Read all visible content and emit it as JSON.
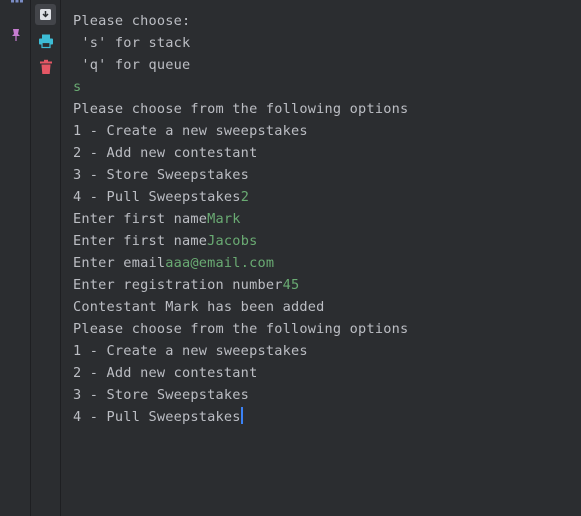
{
  "toolbar": {
    "icons": [
      "grid-icon",
      "pin-icon",
      "scroll-to-end-icon",
      "print-icon",
      "delete-icon"
    ]
  },
  "console": {
    "lines": [
      {
        "out": "Please choose:",
        "in": ""
      },
      {
        "out": " 's' for stack",
        "in": ""
      },
      {
        "out": " 'q' for queue",
        "in": ""
      },
      {
        "out": "",
        "in": "s"
      },
      {
        "out": "Please choose from the following options",
        "in": ""
      },
      {
        "out": "1 - Create a new sweepstakes",
        "in": ""
      },
      {
        "out": "2 - Add new contestant",
        "in": ""
      },
      {
        "out": "3 - Store Sweepstakes",
        "in": ""
      },
      {
        "out": "4 - Pull Sweepstakes",
        "in": "2"
      },
      {
        "out": "Enter first name",
        "in": "Mark"
      },
      {
        "out": "Enter first name",
        "in": "Jacobs"
      },
      {
        "out": "Enter email",
        "in": "aaa@email.com"
      },
      {
        "out": "Enter registration number",
        "in": "45"
      },
      {
        "out": "Contestant Mark has been added",
        "in": ""
      },
      {
        "out": "Please choose from the following options",
        "in": ""
      },
      {
        "out": "1 - Create a new sweepstakes",
        "in": ""
      },
      {
        "out": "2 - Add new contestant",
        "in": ""
      },
      {
        "out": "3 - Store Sweepstakes",
        "in": ""
      },
      {
        "out": "4 - Pull Sweepstakes",
        "in": ""
      }
    ]
  },
  "colors": {
    "output_text": "#bcbec4",
    "user_input": "#6aab73",
    "background": "#2b2d30",
    "caret": "#3b82f6"
  }
}
